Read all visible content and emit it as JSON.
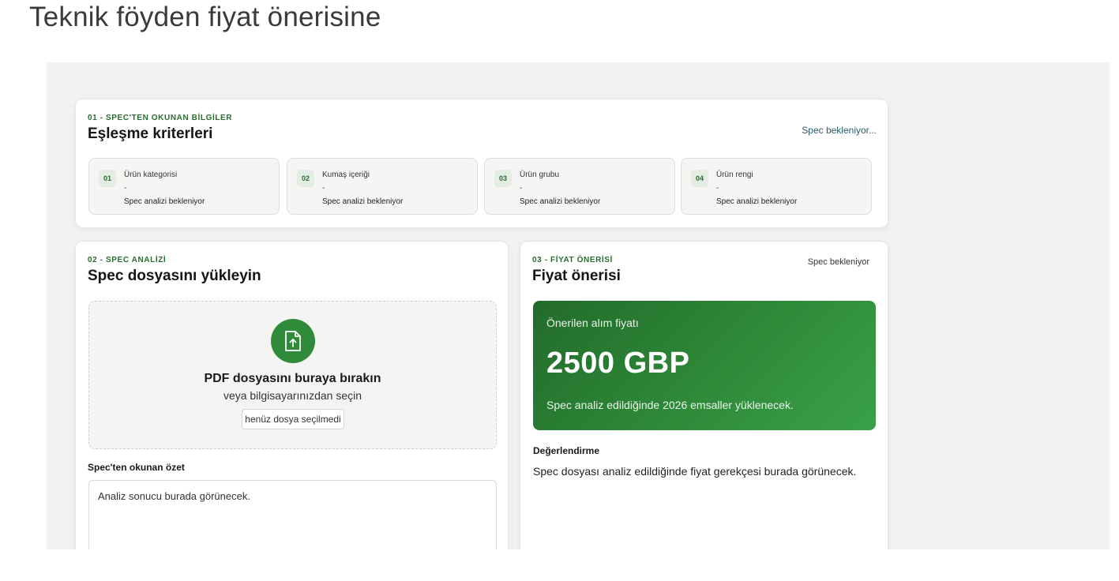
{
  "page": {
    "title": "Teknik föyden fiyat önerisine"
  },
  "criteria": {
    "eyebrow": "01 - SPEC'TEN OKUNAN BİLGİLER",
    "title": "Eşleşme kriterleri",
    "status": "Spec bekleniyor...",
    "items": [
      {
        "num": "01",
        "label": "Ürün kategorisi",
        "value": "-",
        "status": "Spec analizi bekleniyor"
      },
      {
        "num": "02",
        "label": "Kumaş içeriği",
        "value": "-",
        "status": "Spec analizi bekleniyor"
      },
      {
        "num": "03",
        "label": "Ürün grubu",
        "value": "-",
        "status": "Spec analizi bekleniyor"
      },
      {
        "num": "04",
        "label": "Ürün rengi",
        "value": "-",
        "status": "Spec analizi bekleniyor"
      }
    ]
  },
  "spec": {
    "eyebrow": "02 - SPEC ANALİZİ",
    "title": "Spec dosyasını yükleyin",
    "drop_title": "PDF dosyasını buraya bırakın",
    "drop_sub": "veya bilgisayarınızdan seçin",
    "file_button": "henüz dosya seçilmedi",
    "summary_label": "Spec'ten okunan özet",
    "summary_text": "Analiz sonucu burada görünecek.",
    "icon": "file-upload-icon"
  },
  "price": {
    "eyebrow": "03 - FİYAT ÖNERİSİ",
    "title": "Fiyat önerisi",
    "status": "Spec bekleniyor",
    "box_label": "Önerilen alım fiyatı",
    "box_value": "2500 GBP",
    "box_note": "Spec analiz edildiğinde 2026 emsaller yüklenecek.",
    "eval_label": "Değerlendirme",
    "eval_text": "Spec dosyası analiz edildiğinde fiyat gerekçesi burada görünecek.",
    "accent": "#2f8a3a"
  }
}
